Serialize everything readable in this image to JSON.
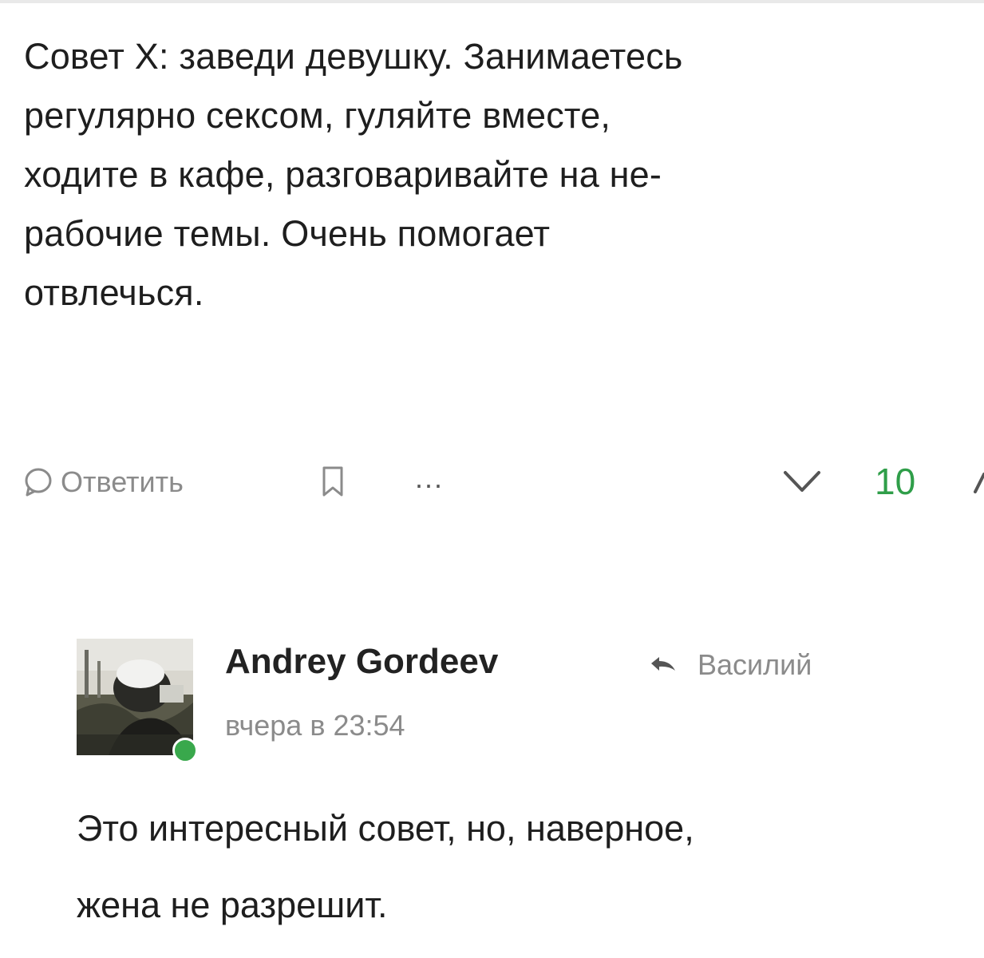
{
  "comment": {
    "lines": [
      "Совет Х: заведи девушку. Занимаетесь",
      "регулярно сексом, гуляйте вместе,",
      "ходите в кафе, разговаривайте на не-",
      "рабочие темы. Очень помогает",
      "отвлечься."
    ],
    "actions": {
      "reply_icon": "speech-bubble-icon",
      "reply_label": "Ответить",
      "bookmark_icon": "bookmark-icon",
      "more_label": "...",
      "vote_down_icon": "chevron-down-icon",
      "vote_count": "10",
      "vote_up_icon": "chevron-up-icon",
      "vote_color": "#2f9e49"
    }
  },
  "reply": {
    "author": "Andrey Gordeev",
    "reply_to_icon": "reply-arrow-icon",
    "reply_to": "Василий",
    "timestamp": "вчера в 23:54",
    "online_color": "#39a84c",
    "lines": [
      "Это интересный совет, но, наверное,",
      "жена не разрешит."
    ]
  }
}
